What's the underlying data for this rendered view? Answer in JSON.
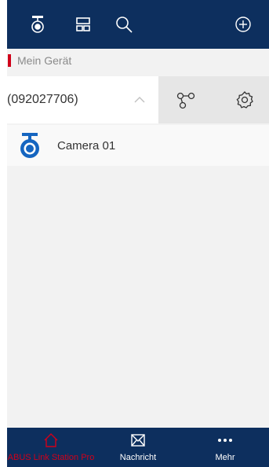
{
  "section": {
    "title": "Mein Gerät"
  },
  "device": {
    "name": "(092027706)"
  },
  "cameras": [
    {
      "label": "Camera 01"
    }
  ],
  "bottom_nav": {
    "home_label": "ABUS Link Station Pro",
    "messages_label": "Nachricht",
    "more_label": "Mehr"
  },
  "colors": {
    "header_bg": "#0d2f5e",
    "accent_red": "#d0001a",
    "camera_blue": "#1565c0"
  },
  "icons": {
    "top": [
      "camera-icon",
      "layout-icon",
      "search-icon",
      "add-circle-icon"
    ],
    "device_actions": [
      "share-icon",
      "settings-gear-icon"
    ],
    "bottom": [
      "home-icon",
      "envelope-icon",
      "more-dots-icon"
    ]
  }
}
